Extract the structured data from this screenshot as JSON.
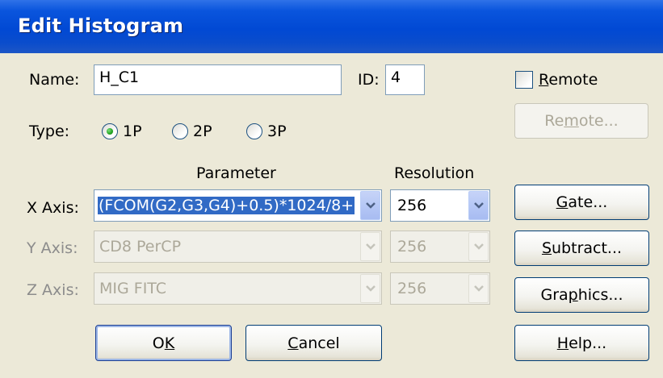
{
  "window": {
    "title": "Edit Histogram"
  },
  "name": {
    "label": "Name:",
    "value": "H_C1"
  },
  "id": {
    "label": "ID:",
    "value": "4"
  },
  "remote_checkbox": {
    "label_mn": "R",
    "label_rest": "emote",
    "checked": false
  },
  "remote_button": {
    "label_pre": "Re",
    "label_mn": "m",
    "label_rest": "ote...",
    "enabled": false
  },
  "type": {
    "label": "Type:",
    "options": [
      {
        "label": "1P",
        "selected": true
      },
      {
        "label": "2P",
        "selected": false
      },
      {
        "label": "3P",
        "selected": false
      }
    ]
  },
  "headers": {
    "parameter": "Parameter",
    "resolution": "Resolution"
  },
  "axes": [
    {
      "label": "X Axis:",
      "parameter": "(FCOM(G2,G3,G4)+0.5)*1024/8+",
      "resolution": "256",
      "enabled": true
    },
    {
      "label": "Y Axis:",
      "parameter": "CD8 PerCP",
      "resolution": "256",
      "enabled": false
    },
    {
      "label": "Z Axis:",
      "parameter": "MIG FITC",
      "resolution": "256",
      "enabled": false
    }
  ],
  "buttons": {
    "ok": {
      "pre": "O",
      "mn": "K",
      "rest": ""
    },
    "cancel": {
      "pre": "",
      "mn": "C",
      "rest": "ancel"
    },
    "gate": {
      "pre": "",
      "mn": "G",
      "rest": "ate..."
    },
    "subtract": {
      "pre": "",
      "mn": "S",
      "rest": "ubtract..."
    },
    "graphics": {
      "pre": "Gra",
      "mn": "p",
      "rest": "hics..."
    },
    "help": {
      "pre": "",
      "mn": "H",
      "rest": "elp..."
    }
  },
  "colors": {
    "titlebar": "#0149d4",
    "dialog_bg": "#ece9d8",
    "radio_dot": "#21a121",
    "combo_arrow": "#4d6185"
  }
}
